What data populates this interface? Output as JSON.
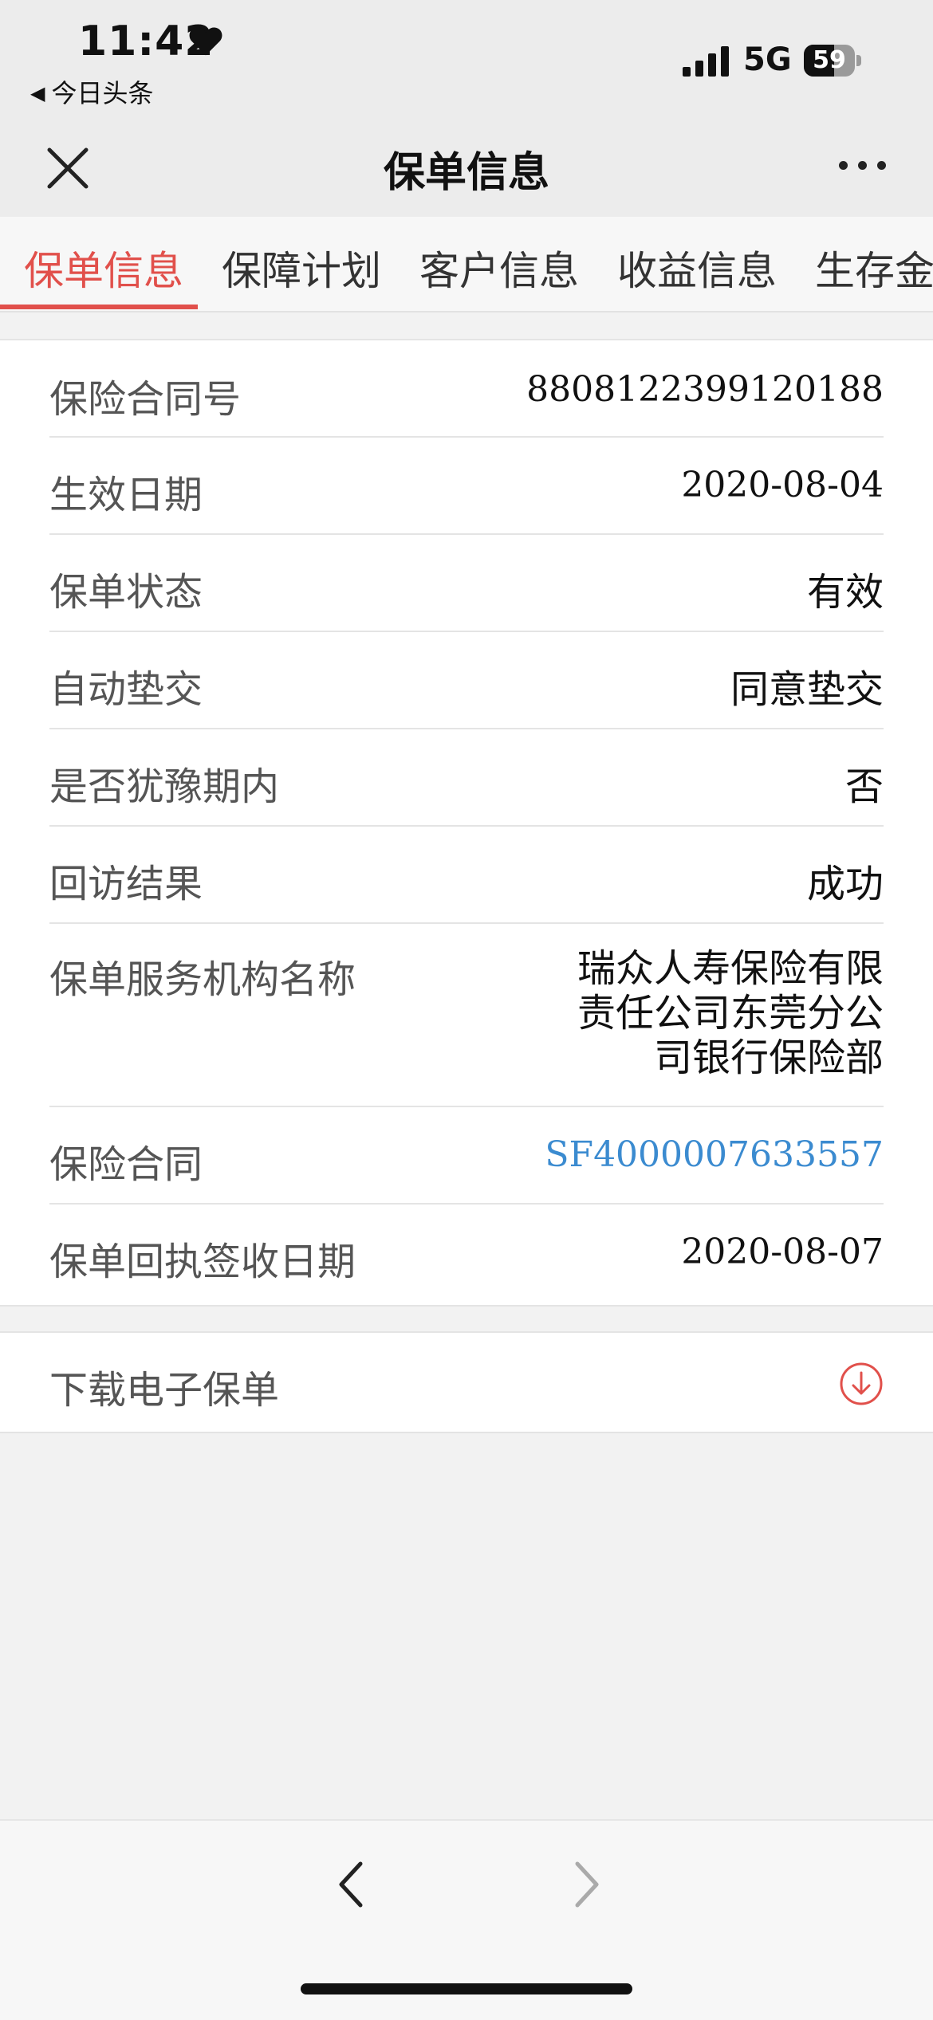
{
  "status_bar": {
    "time": "11:42",
    "back_app": "今日头条",
    "network": "5G",
    "battery": "59",
    "battery_level": 0.59
  },
  "nav": {
    "title": "保单信息",
    "close_icon": "close-icon",
    "more_icon": "more-dots-icon"
  },
  "tabs": [
    {
      "label": "保单信息",
      "active": true
    },
    {
      "label": "保障计划",
      "active": false
    },
    {
      "label": "客户信息",
      "active": false
    },
    {
      "label": "收益信息",
      "active": false
    },
    {
      "label": "生存金",
      "active": false
    }
  ],
  "info": {
    "rows": [
      {
        "label": "保险合同号",
        "value": "8808122399120188"
      },
      {
        "label": "生效日期",
        "value": "2020-08-04"
      },
      {
        "label": "保单状态",
        "value": "有效"
      },
      {
        "label": "自动垫交",
        "value": "同意垫交"
      },
      {
        "label": "是否犹豫期内",
        "value": "否"
      },
      {
        "label": "回访结果",
        "value": "成功"
      },
      {
        "label": "保单服务机构名称",
        "value": "瑞众人寿保险有限责任公司东莞分公司银行保险部"
      },
      {
        "label": "保险合同",
        "value": "SF4000007633557"
      },
      {
        "label": "保单回执签收日期",
        "value": "2020-08-07"
      }
    ]
  },
  "download": {
    "label": "下载电子保单",
    "icon": "download-circle-icon"
  },
  "colors": {
    "accent": "#e1504b",
    "link": "#3b8bd0"
  }
}
